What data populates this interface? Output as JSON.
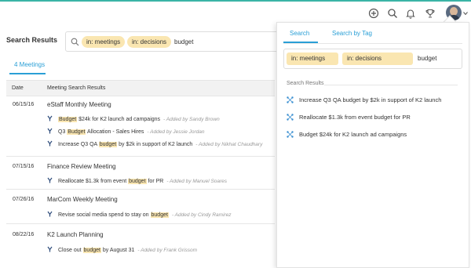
{
  "header": {
    "icons": [
      "add-circle-icon",
      "search-icon",
      "bell-icon",
      "trophy-icon",
      "avatar",
      "chevron-down-icon"
    ]
  },
  "page": {
    "title": "Search Results",
    "search": {
      "chips": [
        "in: meetings",
        "in: decisions"
      ],
      "term": "budget"
    },
    "tab_label": "4 Meetings"
  },
  "table": {
    "columns": [
      "Date",
      "Meeting Search Results"
    ],
    "rows": [
      {
        "date": "06/15/16",
        "title": "eStaff Monthly Meeting",
        "items": [
          {
            "before": "",
            "hl": "Budget",
            "after": " $24k for K2 launch ad campaigns",
            "by": "- Added by Sandy Brown"
          },
          {
            "before": "Q3 ",
            "hl": "Budget",
            "after": " Allocation - Sales Hires",
            "by": "- Added by Jessie Jordan"
          },
          {
            "before": "Increase Q3 QA ",
            "hl": "budget",
            "after": " by $2k in support of K2 launch",
            "by": "- Added by Nikhat Chaudhary"
          }
        ]
      },
      {
        "date": "07/15/16",
        "title": "Finance Review Meeting",
        "items": [
          {
            "before": "Reallocate $1.3k from event ",
            "hl": "budget",
            "after": " for PR",
            "by": "- Added by Manuel Soares"
          }
        ]
      },
      {
        "date": "07/26/16",
        "title": "MarCom Weekly Meeting",
        "items": [
          {
            "before": "Revise social media spend to stay on ",
            "hl": "budget",
            "after": "",
            "by": "- Added by Cindy Ramirez"
          }
        ]
      },
      {
        "date": "08/22/16",
        "title": "K2 Launch Planning",
        "items": [
          {
            "before": "Close out ",
            "hl": "budget",
            "after": " by August 31",
            "by": "- Added by Frank Grissom"
          }
        ]
      }
    ]
  },
  "panel": {
    "tabs": [
      "Search",
      "Search by Tag"
    ],
    "chips": [
      "in: meetings",
      "in: decisions"
    ],
    "term": "budget",
    "section_label": "Search Results",
    "results": [
      "Increase Q3 QA budget by $2k in support of K2 launch",
      "Reallocate $1.3k from event budget for PR",
      "Budget $24k for K2 launch ad campaigns"
    ]
  },
  "colors": {
    "accent": "#2a9fd6",
    "highlight": "#fae6b1",
    "top_stripe": "#3bb4a6"
  }
}
